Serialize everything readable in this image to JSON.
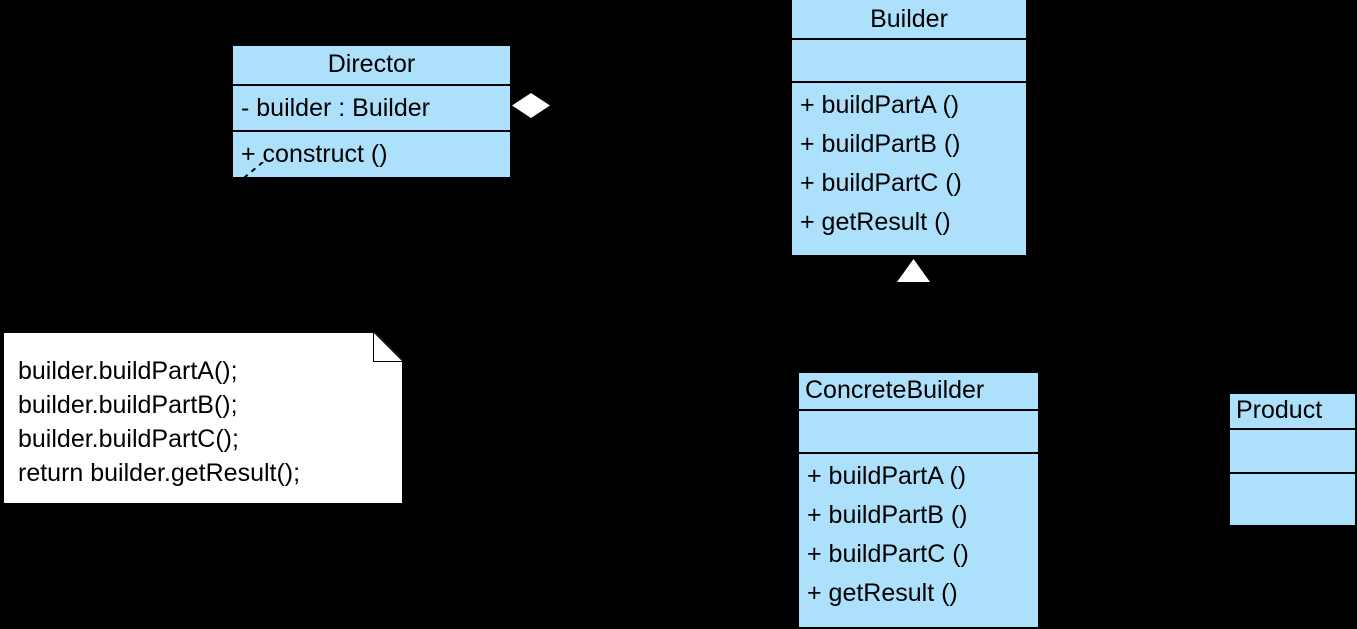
{
  "diagram": {
    "title": "Builder design pattern UML class diagram",
    "background_color": "#000000",
    "class_fill_color": "#ace0fb",
    "class_border_color": "#000000",
    "note_fill_color": "#ffffff"
  },
  "classes": {
    "director": {
      "name": "Director",
      "attributes": [
        "- builder  : Builder"
      ],
      "operations": [
        "+  construct ()"
      ]
    },
    "builder": {
      "name": "Builder",
      "attributes": [],
      "operations": [
        "+  buildPartA ()",
        "+  buildPartB ()",
        "+  buildPartC ()",
        "+  getResult ()"
      ]
    },
    "concrete_builder": {
      "name": "ConcreteBuilder",
      "attributes": [],
      "operations": [
        "+  buildPartA ()",
        "+  buildPartB ()",
        "+  buildPartC ()",
        "+  getResult ()"
      ]
    },
    "product": {
      "name": "Product",
      "attributes": [],
      "operations": []
    }
  },
  "note": {
    "lines": [
      "builder.buildPartA();",
      "builder.buildPartB();",
      "builder.buildPartC();",
      "return builder.getResult();"
    ]
  },
  "relationships": {
    "aggregation": {
      "label": "",
      "from": "Director",
      "to": "Builder",
      "marker": "hollow-diamond"
    },
    "generalization": {
      "label": "",
      "from": "ConcreteBuilder",
      "to": "Builder",
      "marker": "hollow-triangle"
    },
    "note_link": {
      "label": "",
      "from": "Director.construct",
      "to": "note",
      "marker": "dashed"
    }
  }
}
